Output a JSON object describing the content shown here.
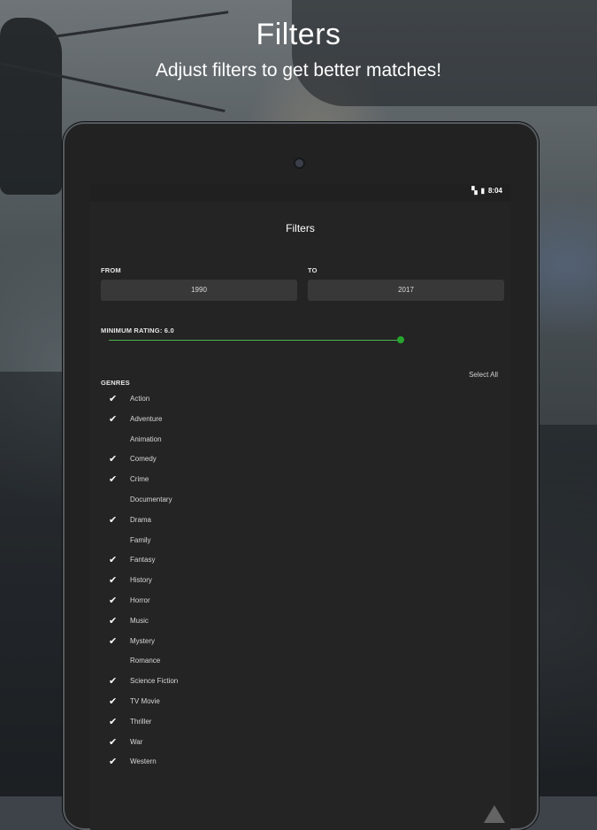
{
  "hero": {
    "title": "Filters",
    "subtitle": "Adjust filters to get better matches!"
  },
  "status_bar": {
    "time": "8:04",
    "icons": [
      "signal-icon",
      "battery-icon"
    ]
  },
  "screen": {
    "title": "Filters",
    "from_label": "FROM",
    "from_value": "1990",
    "to_label": "TO",
    "to_value": "2017",
    "rating_label": "MINIMUM RATING: 6.0",
    "rating_value": 6.0,
    "rating_fraction": 0.6,
    "genres_label": "GENRES",
    "select_all": "Select All",
    "accent_color": "#4caf50",
    "genres": [
      {
        "name": "Action",
        "checked": true
      },
      {
        "name": "Adventure",
        "checked": true
      },
      {
        "name": "Animation",
        "checked": false
      },
      {
        "name": "Comedy",
        "checked": true
      },
      {
        "name": "Crime",
        "checked": true
      },
      {
        "name": "Documentary",
        "checked": false
      },
      {
        "name": "Drama",
        "checked": true
      },
      {
        "name": "Family",
        "checked": false
      },
      {
        "name": "Fantasy",
        "checked": true
      },
      {
        "name": "History",
        "checked": true
      },
      {
        "name": "Horror",
        "checked": true
      },
      {
        "name": "Music",
        "checked": true
      },
      {
        "name": "Mystery",
        "checked": true
      },
      {
        "name": "Romance",
        "checked": false
      },
      {
        "name": "Science Fiction",
        "checked": true
      },
      {
        "name": "TV Movie",
        "checked": true
      },
      {
        "name": "Thriller",
        "checked": true
      },
      {
        "name": "War",
        "checked": true
      },
      {
        "name": "Western",
        "checked": true
      }
    ]
  }
}
